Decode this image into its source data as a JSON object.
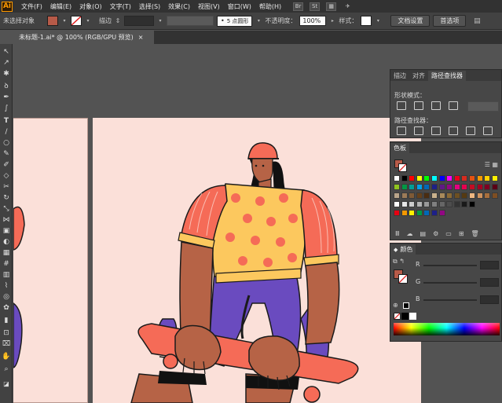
{
  "menu": {
    "logo": "Ai",
    "items": [
      "文件(F)",
      "编辑(E)",
      "对象(O)",
      "文字(T)",
      "选择(S)",
      "效果(C)",
      "视图(V)",
      "窗口(W)",
      "帮助(H)"
    ],
    "bridge": "Br",
    "stock": "St"
  },
  "control": {
    "selection": "未选择对象",
    "stroke_label": "描边",
    "brush": "5 点圆形",
    "opacity_label": "不透明度：",
    "opacity_value": "100%",
    "style_label": "样式：",
    "doc_setup": "文档设置",
    "preferences": "首选项",
    "fill_color": "#b65a48"
  },
  "document": {
    "tab_title": "未标题-1.ai* @ 100% (RGB/GPU 预览)",
    "close": "×"
  },
  "pathfinder_panel": {
    "tabs": [
      "描边",
      "对齐",
      "路径查找器"
    ],
    "shape_modes": "形状模式：",
    "pathfinders": "路径查找器："
  },
  "swatches_panel": {
    "title": "色板",
    "colors": [
      [
        "#ffffff",
        "#000000",
        "#ff0000",
        "#ffff00",
        "#00ff00",
        "#00ffff",
        "#0000ff",
        "#ff00ff",
        "#e8001b",
        "#d62b1e",
        "#e35212",
        "#f39800",
        "#ffd100",
        "#fff100"
      ],
      [
        "#8fc31f",
        "#009944",
        "#009e96",
        "#00a0e9",
        "#0068b7",
        "#1d2088",
        "#601986",
        "#920783",
        "#e4007f",
        "#e5004f",
        "#c30d23",
        "#a50021",
        "#7d0022",
        "#5a0016"
      ],
      [
        "#b9a48a",
        "#9c7b58",
        "#7f5a36",
        "#64401c",
        "#4a2c10",
        "#c9b18c",
        "#a88a5b",
        "#8b6a35",
        "#6d5022",
        "#553a12",
        "#eeb782",
        "#d0935e",
        "#a86f3d",
        "#7e4e23"
      ],
      [
        "#ffffff",
        "#e6e6e6",
        "#cccccc",
        "#b3b3b3",
        "#999999",
        "#808080",
        "#666666",
        "#4d4d4d",
        "#333333",
        "#1a1a1a",
        "#000000"
      ],
      [
        "#e60012",
        "#f39800",
        "#fff100",
        "#009944",
        "#0068b7",
        "#1d2088",
        "#920783"
      ]
    ]
  },
  "color_panel": {
    "title": "颜色",
    "channels": [
      "R",
      "G",
      "B"
    ],
    "fill": "#b65a48"
  }
}
